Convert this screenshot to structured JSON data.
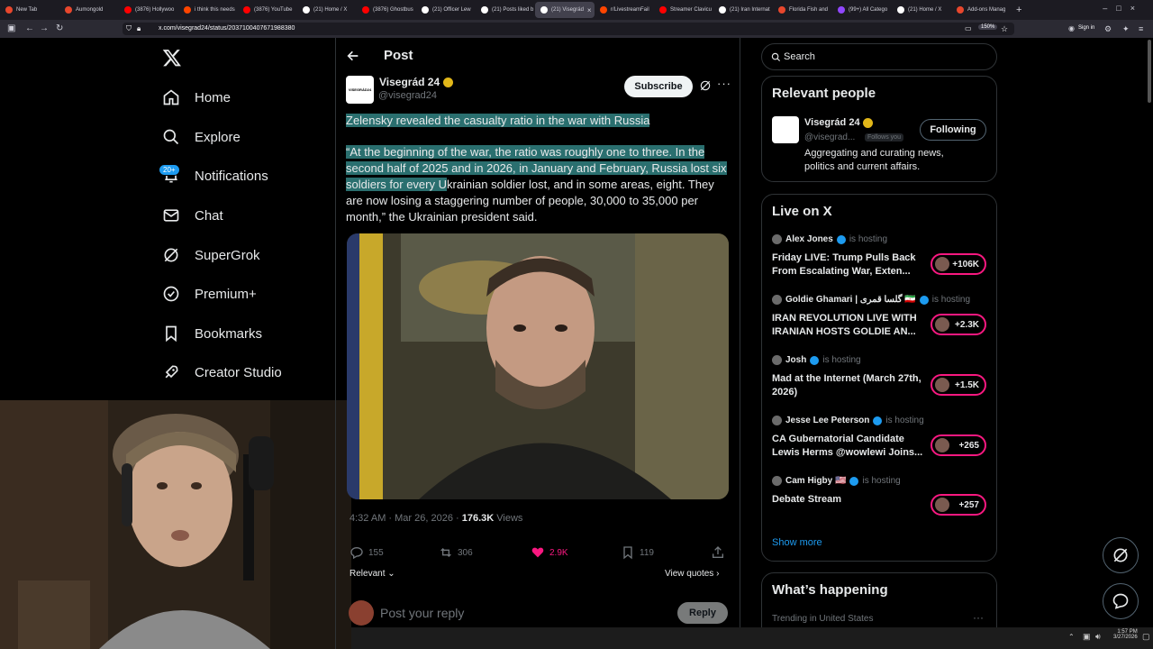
{
  "browser": {
    "tabs": [
      {
        "label": "New Tab",
        "color": "#e8472d"
      },
      {
        "label": "Aumongold",
        "color": "#e8472d"
      },
      {
        "label": "(3876) Hollywoo",
        "color": "#ff0000"
      },
      {
        "label": "i think this needs",
        "color": "#ff4500"
      },
      {
        "label": "(3876) YouTube",
        "color": "#ff0000"
      },
      {
        "label": "(21) Home / X",
        "color": "#ffffff"
      },
      {
        "label": "(3876) Ghostbus",
        "color": "#ff0000"
      },
      {
        "label": "(21) Officer Lew",
        "color": "#ffffff"
      },
      {
        "label": "(21) Posts liked b",
        "color": "#ffffff"
      },
      {
        "label": "(21) Visegrád",
        "color": "#ffffff",
        "active": true
      },
      {
        "label": "r/LivestreamFail",
        "color": "#ff4500"
      },
      {
        "label": "Streamer Clavicu",
        "color": "#ff0000"
      },
      {
        "label": "(21) Iran Internat",
        "color": "#ffffff"
      },
      {
        "label": "Florida Fish and",
        "color": "#e8472d"
      },
      {
        "label": "(99+) All Catego",
        "color": "#9147ff"
      },
      {
        "label": "(21) Home / X",
        "color": "#ffffff"
      },
      {
        "label": "Add-ons Manag",
        "color": "#e8472d"
      }
    ],
    "url": "x.com/visegrad24/status/2037100407671988380",
    "zoom": "150%",
    "sign_in": "Sign in"
  },
  "nav": {
    "items": [
      {
        "label": "Home"
      },
      {
        "label": "Explore"
      },
      {
        "label": "Notifications",
        "badge": "20+"
      },
      {
        "label": "Chat"
      },
      {
        "label": "SuperGrok"
      },
      {
        "label": "Premium+"
      },
      {
        "label": "Bookmarks"
      },
      {
        "label": "Creator Studio"
      }
    ]
  },
  "post": {
    "header_title": "Post",
    "author_name": "Visegrád 24",
    "author_handle": "@visegrad24",
    "avatar_text": "VISEGRÁD24",
    "subscribe_label": "Subscribe",
    "title": "Zelensky revealed the casualty ratio in the war with Russia",
    "body_highlighted": "“At the beginning of the war, the ratio was roughly one to three. In the second half of 2025 and in 2026, in January and February, Russia lost six soldiers for every U",
    "body_rest": "krainian soldier lost, and in some areas, eight. They are now losing a staggering number of people, 30,000 to 35,000 per month,” the Ukrainian president said.",
    "timestamp": "4:32 AM · Mar 26, 2026 · ",
    "views_count": "176.3K",
    "views_label": " Views",
    "replies": "155",
    "reposts": "306",
    "likes": "2.9K",
    "bookmarks": "119",
    "sort_label": "Relevant",
    "view_quotes": "View quotes",
    "reply_placeholder": "Post your reply",
    "reply_button": "Reply"
  },
  "sidebar": {
    "search_placeholder": "Search",
    "relevant_title": "Relevant people",
    "relevant_person": {
      "name": "Visegrád 24",
      "handle": "@visegrad...",
      "follows_you": "Follows you",
      "following_label": "Following",
      "bio": "Aggregating and curating news, politics and current affairs."
    },
    "live_title": "Live on X",
    "live_items": [
      {
        "host": "Alex Jones",
        "status": "is hosting",
        "title": "Friday LIVE: Trump Pulls Back From Escalating War, Exten...",
        "count": "+106K"
      },
      {
        "host": "Goldie Ghamari | گلسا قمری 🇮🇷",
        "status": "is hosting",
        "title": "IRAN REVOLUTION LIVE WITH IRANIAN HOSTS GOLDIE AN...",
        "count": "+2.3K"
      },
      {
        "host": "Josh",
        "status": "is hosting",
        "title": "Mad at the Internet (March 27th, 2026)",
        "count": "+1.5K"
      },
      {
        "host": "Jesse Lee Peterson",
        "status": "is hosting",
        "title": "CA Gubernatorial Candidate Lewis Herms @wowlewi Joins...",
        "count": "+265"
      },
      {
        "host": "Cam Higby 🇺🇸",
        "status": "is hosting",
        "title": "Debate Stream",
        "count": "+257"
      }
    ],
    "show_more": "Show more",
    "happening_title": "What’s happening",
    "trending_label": "Trending in United States"
  },
  "taskbar": {
    "time": "1:57 PM",
    "date": "3/27/2026"
  },
  "colors": {
    "accent": "#1d9bf0",
    "like": "#f91880",
    "highlight": "#2a6f6f"
  }
}
